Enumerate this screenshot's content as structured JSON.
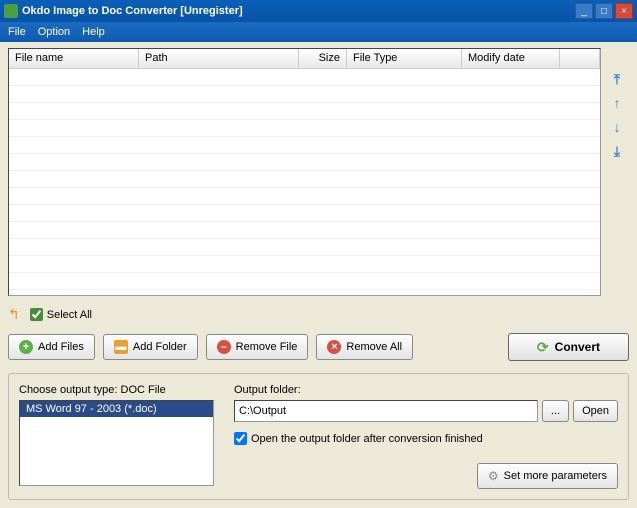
{
  "window": {
    "title": "Okdo Image to Doc Converter [Unregister]"
  },
  "menu": {
    "file": "File",
    "option": "Option",
    "help": "Help"
  },
  "table": {
    "headers": {
      "filename": "File name",
      "path": "Path",
      "size": "Size",
      "filetype": "File Type",
      "modifydate": "Modify date"
    }
  },
  "selectAll": {
    "label": "Select All",
    "checked": true
  },
  "buttons": {
    "addFiles": "Add Files",
    "addFolder": "Add Folder",
    "removeFile": "Remove File",
    "removeAll": "Remove All",
    "convert": "Convert",
    "browse": "...",
    "open": "Open",
    "setMoreParams": "Set more parameters"
  },
  "outputType": {
    "label": "Choose output type:  DOC File",
    "selected": "MS Word 97 - 2003 (*.doc)"
  },
  "outputFolder": {
    "label": "Output folder:",
    "value": "C:\\Output",
    "openAfter": {
      "label": "Open the output folder after conversion finished",
      "checked": true
    }
  }
}
